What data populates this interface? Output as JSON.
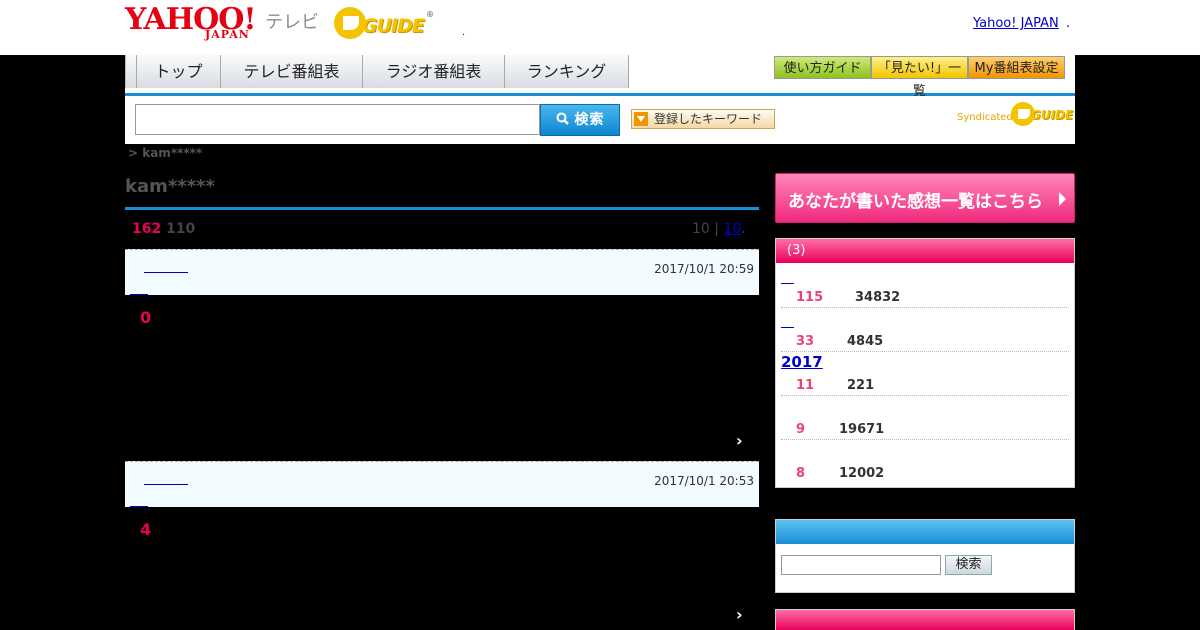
{
  "header": {
    "yahoo_logo": "YAHOO!",
    "yahoo_sub": "JAPAN",
    "tv_label": "テレビ",
    "gguide_logo": "GUIDE",
    "gguide_reg": "®",
    "dot": ".",
    "yahoo_japan_link": "Yahoo! JAPAN",
    "link_tail": "."
  },
  "nav": {
    "tabs": [
      "トップ",
      "テレビ番組表",
      "ラジオ番組表",
      "ランキング"
    ],
    "buttons": [
      "使い方ガイド",
      "「見たい!」一覧",
      "My番組表設定"
    ]
  },
  "search": {
    "placeholder": "",
    "button_label": "検索",
    "keyword_button": "登録したキーワード",
    "syndicated": "Syndicated",
    "syndicated_logo": "GUIDE"
  },
  "breadcrumb": "> kam*****",
  "page_title": "kam*****",
  "counts": {
    "primary": "162",
    "secondary": "110"
  },
  "pager": {
    "text": "10 |",
    "link": "10",
    "tail": "."
  },
  "reviews": [
    {
      "date": "2017/10/1 20:59",
      "rating": "0",
      "more": "›",
      "dot": "."
    },
    {
      "date": "2017/10/1 20:53",
      "rating": "4",
      "more": "›",
      "dot": "."
    }
  ],
  "right": {
    "banner": "あなたが書いた感想一覧はこちら",
    "box1_title": "(3)",
    "items": [
      {
        "title": "",
        "n1": "115",
        "n2": "34832"
      },
      {
        "title": "",
        "n1": "33",
        "n2": "4845"
      },
      {
        "title": "2017",
        "n1": "11",
        "n2": "221"
      },
      {
        "title": "",
        "n1": "9",
        "n2": "19671"
      },
      {
        "title": "",
        "n1": "8",
        "n2": "12002"
      }
    ],
    "box2_title": "",
    "box2_button": "検索"
  }
}
